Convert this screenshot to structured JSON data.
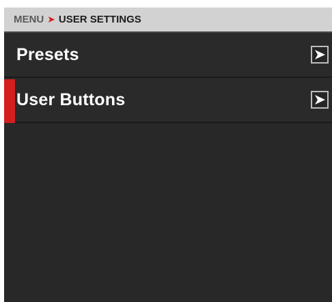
{
  "breadcrumb": {
    "root": "MENU",
    "current": "USER SETTINGS"
  },
  "menu": {
    "items": [
      {
        "label": "Presets",
        "selected": false,
        "icon": "chevron-right-icon"
      },
      {
        "label": "User Buttons",
        "selected": true,
        "icon": "chevron-right-icon"
      }
    ]
  },
  "colors": {
    "accent": "#d41f1f",
    "background": "#282828",
    "header": "#d2d2d2"
  }
}
